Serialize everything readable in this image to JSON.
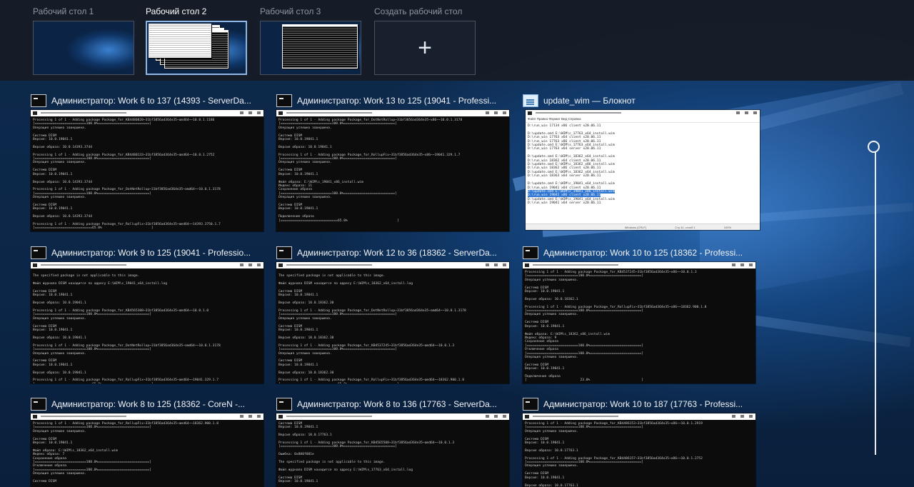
{
  "desktops": [
    {
      "label": "Рабочий стол 1",
      "active": false
    },
    {
      "label": "Рабочий стол 2",
      "active": true
    },
    {
      "label": "Рабочий стол 3",
      "active": false
    }
  ],
  "new_desktop": {
    "label": "Создать рабочий стол",
    "icon": "plus-icon"
  },
  "windows": [
    {
      "title": "Администратор:  Work 6 to 137 (14393 - ServerDa...",
      "icon": "cmd-icon",
      "lines": [
        "Processing 1 of 1 - Adding package Package_for_KB4480820~31bf3856ad364e35~amd64~~10.0.1.1186",
        "[==========================100.0%==========================]",
        "Операция успешно завершена.",
        "",
        "Система DISM",
        "Версия: 10.0.19041.1",
        "",
        "Версия образа: 10.0.14393.3744",
        "",
        "Processing 1 of 1 - Adding package Package_for_KB4480133~31bf3856ad364e35~amd64~~10.0.1.2752",
        "[==========================100.0%==========================]",
        "Операция успешно завершена.",
        "",
        "Система DISM",
        "Версия: 10.0.19041.1",
        "",
        "Версия образа: 10.0.14393.3744",
        "",
        "Processing 1 of 1 - Adding package Package_for_DotNetRollup~31bf3856ad364e35~amd64~~10.0.1.3178",
        "[==========================100.0%==========================]",
        "Операция успешно завершена.",
        "",
        "Система DISM",
        "Версия: 10.0.19041.1",
        "",
        "Версия образа: 10.0.14393.3744",
        "",
        "Processing 1 of 1 - Adding package Package_for_RollupFix~31bf3856ad364e35~amd64~~14393.3750.1.7",
        "[=============================65.0%                         ]"
      ]
    },
    {
      "title": "Администратор:  Work 13 to 125 (19041 - Professi...",
      "icon": "cmd-icon",
      "lines": [
        "Processing 1 of 1 - Adding package Package_for_DotNetRollup~31bf3856ad364e35~x86~~10.0.1.3178",
        "[==========================100.0%==========================]",
        "Операция успешно завершена.",
        "",
        "Система DISM",
        "Версия: 10.0.19041.1",
        "",
        "Версия образа: 10.0.19041.1",
        "",
        "Processing 1 of 1 - Adding package Package_for_RollupFix~31bf3856ad364e35~x86~~19041.329.1.7",
        "[==========================100.0%==========================]",
        "Операция успешно завершена.",
        "",
        "Система DISM",
        "Версия: 10.0.19041.1",
        "",
        "Файл образа: E:\\WIM\\c_19041_x86_install.wim",
        "Индекс образа: 11",
        "Сохранение образа",
        "[==========================100.0%==========================]",
        "Операция успешно завершена.",
        "",
        "Система DISM",
        "Версия: 10.0.19041.1",
        "",
        "Подключение образа",
        "[=============================65.0%                         ]"
      ]
    },
    {
      "title": "update_wim — Блокнот",
      "icon": "notepad-icon",
      "menu": "Файл  Правка  Формат  Вид  Справка",
      "lines": [
        "D:\\run_win 17134 x86 client x20.06.11",
        "",
        "D:\\update.cmd E:\\WIM\\c_17763_x64_install.wim",
        "D:\\run_win 17763 x64 client x20.06.11",
        "D:\\run_win 17763 x86 client x20.06.11",
        "D:\\update.cmd E:\\WIM\\s_17763_x64_install.wim",
        "D:\\run_win 17763 x64 server x20.06.11",
        "",
        "D:\\update.cmd E:\\WIM\\c_18362_x64_install.wim",
        "D:\\run_win 18362 x64 client x20.06.11",
        "D:\\update.cmd E:\\WIM\\c_18362_x86_install.wim",
        "D:\\run_win 18362 x86 client x20.06.11",
        "D:\\update.cmd E:\\WIM\\s_18362_x64_install.wim",
        "D:\\run_win 18363 x64 server x20.06.11",
        "",
        "D:\\update.cmd E:\\WIM\\c_19041_x64_install.wim",
        "D:\\run_win 19041 x64 client x20.06.11",
        "D:\\update.cmd E:\\WIM\\c_19041_x86_install.wim",
        "D:\\run_win 19041 x86 client x20.06.11",
        "D:\\update.cmd E:\\WIM\\s_19041_x64_install.wim",
        "D:\\run_win 19041 x64 server x20.06.11"
      ],
      "selected": [
        17,
        18
      ],
      "status": [
        "Windows (CRLF)",
        "Стр 41, столб 1",
        "100%"
      ]
    },
    {
      "title": "Администратор:  Work 9 to 125 (19041 - Professio...",
      "icon": "cmd-icon",
      "lines": [
        "",
        "The specified package is not applicable to this image.",
        "",
        "Файл журнала DISM находится по адресу E:\\WIM\\c_19041_x64_install.log",
        "",
        "Система DISM",
        "Версия: 10.0.19041.1",
        "",
        "Версия образа: 10.0.19041.1",
        "",
        "Processing 1 of 1 - Adding package Package_for_KB4565308~31bf3856ad364e35~amd64~~10.0.1.0",
        "[==========================100.0%==========================]",
        "Операция успешно завершена.",
        "",
        "Система DISM",
        "Версия: 10.0.19041.1",
        "",
        "Версия образа: 10.0.19041.1",
        "",
        "Processing 1 of 1 - Adding package Package_for_DotNetRollup~31bf3856ad364e35~amd64~~10.0.1.3178",
        "[==========================100.0%==========================]",
        "Операция успешно завершена.",
        "",
        "Система DISM",
        "Версия: 10.0.19041.1",
        "",
        "Версия образа: 10.0.19041.1",
        "",
        "Processing 1 of 1 - Adding package Package_for_RollupFix~31bf3856ad364e35~amd64~~19041.329.1.7",
        "[=============================65.0%                         ]"
      ]
    },
    {
      "title": "Администратор:  Work 12 to 36 (18362 - ServerDa...",
      "icon": "cmd-icon",
      "lines": [
        "",
        "The specified package is not applicable to this image.",
        "",
        "Файл журнала DISM находится по адресу E:\\WIM\\s_18362_x64_install.log",
        "",
        "Система DISM",
        "Версия: 10.0.19041.1",
        "",
        "Версия образа: 10.0.18362.30",
        "",
        "Processing 1 of 1 - Adding package Package_for_DotNetRollup~31bf3856ad364e35~amd64~~10.0.1.3178",
        "[==========================100.0%==========================]",
        "Операция успешно завершена.",
        "",
        "Система DISM",
        "Версия: 10.0.19041.1",
        "",
        "Версия образа: 10.0.18362.30",
        "",
        "Processing 1 of 1 - Adding package Package_for_KB4537245~31bf3856ad364e35~amd64~~10.0.1.3",
        "[==========================100.0%==========================]",
        "Операция успешно завершена.",
        "",
        "Система DISM",
        "Версия: 10.0.19041.1",
        "",
        "Версия образа: 10.0.18362.30",
        "",
        "Processing 1 of 1 - Adding package Package_for_RollupFix~31bf3856ad364e35~amd64~~18362.900.1.8",
        "[=============================65.0%                         ]"
      ]
    },
    {
      "title": "Администратор:  Work 10 to 125 (18362 - Professi...",
      "icon": "cmd-icon",
      "lines": [
        "Processing 1 of 1 - Adding package Package_for_KB4537245~31bf3856ad364e35~x86~~10.0.1.3",
        "[==========================100.0%==========================]",
        "Операция успешно завершена.",
        "",
        "Система DISM",
        "Версия: 10.0.19041.1",
        "",
        "Версия образа: 10.0.18362.1",
        "",
        "Processing 1 of 1 - Adding package Package_for_RollupFix~31bf3856ad364e35~x86~~18362.900.1.8",
        "[==========================100.0%==========================]",
        "Операция успешно завершена.",
        "",
        "Система DISM",
        "Версия: 10.0.19041.1",
        "",
        "Файл образа: E:\\WIM\\c_18362_x86_install.wim",
        "Индекс образа: 9",
        "Сохранение образа",
        "[==========================100.0%==========================]",
        "Отключение образа",
        "[==========================100.0%==========================]",
        "Операция успешно завершена.",
        "",
        "Система DISM",
        "Версия: 10.0.19041.1",
        "",
        "Подключение образа",
        "[                           23.0%                          ]"
      ]
    },
    {
      "title": "Администратор:  Work 8 to 125 (18362 - CoreN -...",
      "icon": "cmd-icon",
      "lines": [
        "Processing 1 of 1 - Adding package Package_for_RollupFix~31bf3856ad364e35~amd64~~18362.900.1.8",
        "[==========================100.0%==========================]",
        "Операция успешно завершена.",
        "",
        "Система DISM",
        "Версия: 10.0.19041.1",
        "",
        "Файл образа: E:\\WIM\\c_18362_x64_install.wim",
        "Индекс образа: 7",
        "Сохранение образа",
        "[==========================100.0%==========================]",
        "Отключение образа",
        "[==========================100.0%==========================]",
        "Операция успешно завершена.",
        "",
        "Система DISM"
      ]
    },
    {
      "title": "Администратор:  Work 8 to 136 (17763 - ServerDa...",
      "icon": "cmd-icon",
      "lines": [
        "Система DISM",
        "Версия: 10.0.19041.1",
        "",
        "Версия образа: 10.0.17763.1",
        "",
        "Processing 1 of 1 - Adding package Package_for_KB4565508~31bf3856ad364e35~amd64~~10.0.1.3",
        "[==========================100.0%==========================]",
        "",
        "Ошибка: 0x800f081e",
        "",
        "The specified package is not applicable to this image.",
        "",
        "Файл журнала DISM находится по адресу E:\\WIM\\s_17763_x64_install.log",
        "",
        "Система DISM",
        "Версия: 10.0.19041.1"
      ]
    },
    {
      "title": "Администратор:  Work 10 to 187 (17763 - Professi...",
      "icon": "cmd-icon",
      "lines": [
        "Processing 1 of 1 - Adding package Package_for_KB4486153~31bf3856ad364e35~x86~~10.0.1.2919",
        "[==========================100.0%==========================]",
        "Операция успешно завершена.",
        "",
        "Система DISM",
        "Версия: 10.0.19041.1",
        "",
        "Версия образа: 10.0.17763.1",
        "",
        "Processing 1 of 1 - Adding package Package_for_KB4486157~31bf3856ad364e35~x86~~10.0.1.2752",
        "[==========================100.0%==========================]",
        "Операция успешно завершена.",
        "",
        "Система DISM",
        "Версия: 10.0.19041.1",
        "",
        "Версия образа: 10.0.17763.1"
      ]
    }
  ]
}
